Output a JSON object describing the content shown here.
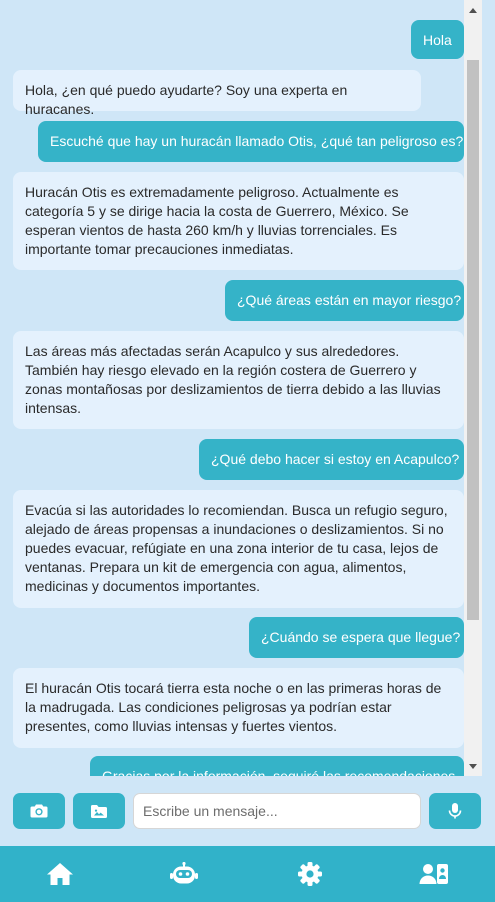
{
  "messages": [
    {
      "role": "user",
      "text": "Hola"
    },
    {
      "role": "bot",
      "text": "Hola, ¿en qué puedo ayudarte? Soy una experta en huracanes."
    },
    {
      "role": "user",
      "text": "Escuché que hay un huracán llamado Otis, ¿qué tan peligroso es?"
    },
    {
      "role": "bot",
      "text": "Huracán Otis es extremadamente peligroso. Actualmente es categoría 5 y se dirige hacia la costa de Guerrero, México. Se esperan vientos de hasta 260 km/h y lluvias torrenciales. Es importante tomar precauciones inmediatas."
    },
    {
      "role": "user",
      "text": "¿Qué áreas están en mayor riesgo?"
    },
    {
      "role": "bot",
      "text": "Las áreas más afectadas serán Acapulco y sus alrededores. También hay riesgo elevado en la región costera de Guerrero y zonas montañosas por deslizamientos de tierra debido a las lluvias intensas."
    },
    {
      "role": "user",
      "text": "¿Qué debo hacer si estoy en Acapulco?"
    },
    {
      "role": "bot",
      "text": "Evacúa si las autoridades lo recomiendan. Busca un refugio seguro, alejado de áreas propensas a inundaciones o deslizamientos. Si no puedes evacuar, refúgiate en una zona interior de tu casa, lejos de ventanas. Prepara un kit de emergencia con agua, alimentos, medicinas y documentos importantes."
    },
    {
      "role": "user",
      "text": "¿Cuándo se espera que llegue?"
    },
    {
      "role": "bot",
      "text": "El huracán Otis tocará tierra esta noche o en las primeras horas de la madrugada. Las condiciones peligrosas ya podrían estar presentes, como lluvias intensas y fuertes vientos."
    },
    {
      "role": "user",
      "text": "Gracias por la información, seguiré las recomendaciones."
    }
  ],
  "input": {
    "placeholder": "Escribe un mensaje...",
    "value": ""
  },
  "icons": {
    "camera": "camera-icon",
    "folder": "folder-icon",
    "mic": "microphone-icon",
    "home": "home-icon",
    "bot": "robot-icon",
    "settings": "gear-icon",
    "contacts": "contacts-icon"
  },
  "colors": {
    "background": "#cfe6f7",
    "accent": "#35b3c8",
    "bot_bubble": "#e4f1fd",
    "nav": "#31b2c9"
  }
}
